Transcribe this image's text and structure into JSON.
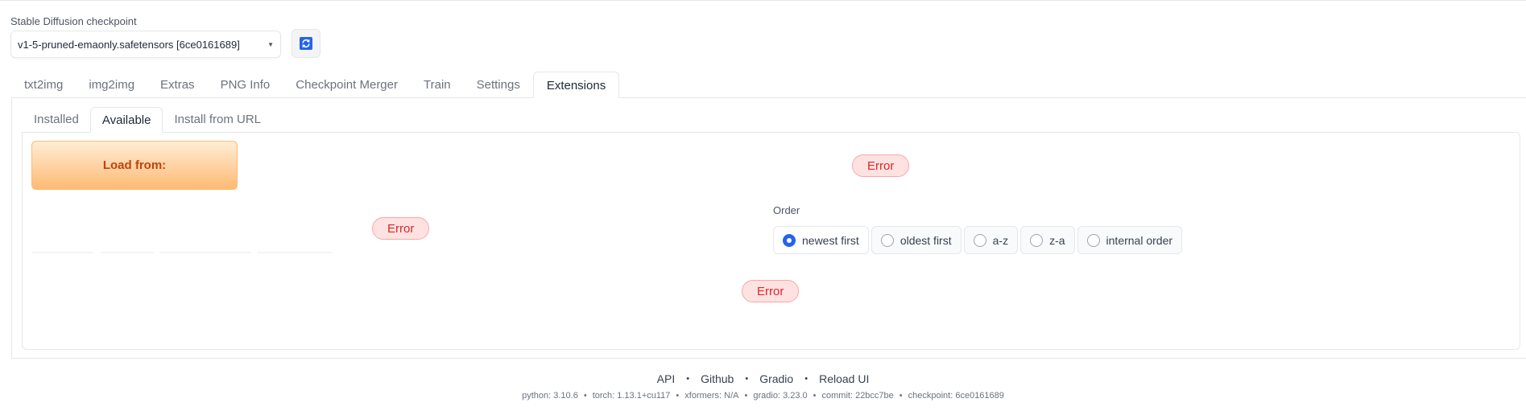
{
  "checkpoint": {
    "label": "Stable Diffusion checkpoint",
    "value": "v1-5-pruned-emaonly.safetensors [6ce0161689]"
  },
  "main_tabs": [
    "txt2img",
    "img2img",
    "Extras",
    "PNG Info",
    "Checkpoint Merger",
    "Train",
    "Settings",
    "Extensions"
  ],
  "active_main_tab": "Extensions",
  "sub_tabs": [
    "Installed",
    "Available",
    "Install from URL"
  ],
  "active_sub_tab": "Available",
  "available": {
    "load_button": "Load from:",
    "errors": [
      "Error",
      "Error",
      "Error"
    ],
    "order": {
      "label": "Order",
      "options": [
        "newest first",
        "oldest first",
        "a-z",
        "z-a",
        "internal order"
      ],
      "selected": "newest first"
    }
  },
  "footer": {
    "links": [
      "API",
      "Github",
      "Gradio",
      "Reload UI"
    ],
    "separator": "•",
    "versions": [
      "python: 3.10.6",
      "torch: 1.13.1+cu117",
      "xformers: N/A",
      "gradio: 3.23.0",
      "commit: 22bcc7be",
      "checkpoint: 6ce0161689"
    ]
  },
  "colors": {
    "accent": "#2563eb",
    "load_button": "#fdba74",
    "error": "#dc2626"
  }
}
